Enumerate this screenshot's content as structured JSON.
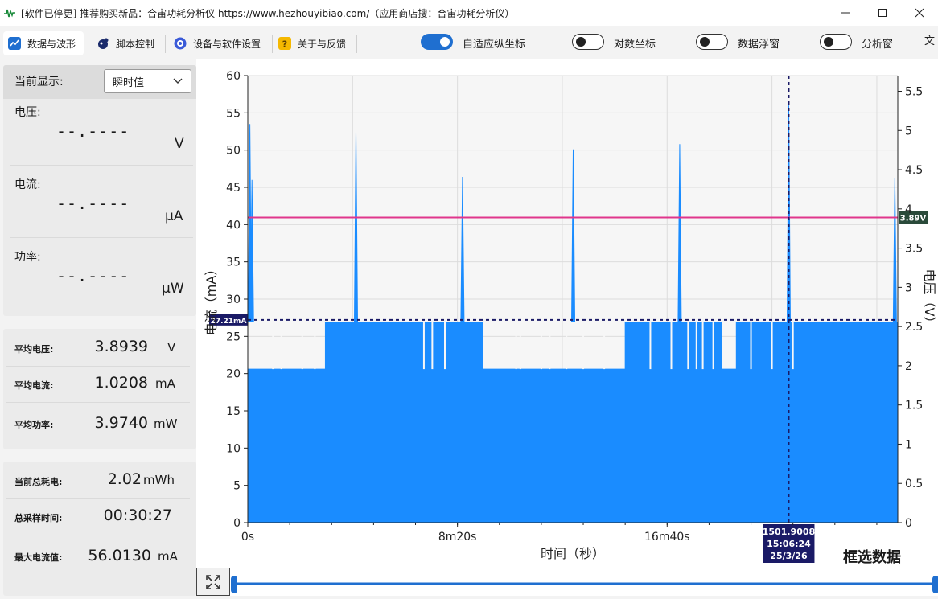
{
  "window": {
    "title": "[软件已停更] 推荐购买新品：合宙功耗分析仪 https://www.hezhouyibiao.com/（应用商店搜：合宙功耗分析仪）"
  },
  "toolbar": {
    "tabs": [
      {
        "label": "数据与波形",
        "icon": "chart-line-icon"
      },
      {
        "label": "脚本控制",
        "icon": "script-icon"
      },
      {
        "label": "设备与软件设置",
        "icon": "gear-icon"
      },
      {
        "label": "关于与反馈",
        "icon": "question-icon"
      }
    ],
    "toggles": [
      {
        "label": "自适应纵坐标",
        "on": true
      },
      {
        "label": "对数坐标",
        "on": false
      },
      {
        "label": "数据浮窗",
        "on": false
      },
      {
        "label": "分析窗",
        "on": false
      }
    ],
    "lang_icon": "translate-icon"
  },
  "left": {
    "current_label": "当前显示:",
    "current_value": "瞬时值",
    "meters": [
      {
        "label": "电压:",
        "value": "--.----",
        "unit": "V"
      },
      {
        "label": "电流:",
        "value": "--.----",
        "unit": "μA"
      },
      {
        "label": "功率:",
        "value": "--.----",
        "unit": "μW"
      }
    ],
    "averages": [
      {
        "label": "平均电压:",
        "value": "3.8939",
        "unit": "V"
      },
      {
        "label": "平均电流:",
        "value": "1.0208",
        "unit": "mA"
      },
      {
        "label": "平均功率:",
        "value": "3.9740",
        "unit": "mW"
      }
    ],
    "totals": [
      {
        "label": "当前总耗电:",
        "value": "2.02",
        "unit": "mWh"
      },
      {
        "label": "总采样时间:",
        "value": "00:30:27",
        "unit": ""
      },
      {
        "label": "最大电流值:",
        "value": "56.0130",
        "unit": "mA"
      }
    ]
  },
  "colors": {
    "accent": "#1f6fd0",
    "current": "#1a8cff",
    "voltage": "#e0368c",
    "marker": "#1a1a66"
  },
  "chart_data": {
    "type": "area",
    "xlabel": "时间（秒）",
    "ylabel": "电流（mA）",
    "ylabel_right": "电压（V）",
    "xlim": [
      0,
      1550
    ],
    "ylim": [
      0,
      60
    ],
    "ylim_right": [
      0,
      5.7
    ],
    "x_ticks": [
      {
        "value": 0,
        "label": "0s"
      },
      {
        "value": 500,
        "label": "8m20s"
      },
      {
        "value": 1000,
        "label": "16m40s"
      }
    ],
    "y_ticks": [
      0,
      5,
      10,
      15,
      20,
      25,
      30,
      35,
      40,
      45,
      50,
      55,
      60
    ],
    "y_ticks_right": [
      0,
      0.5,
      1,
      1.5,
      2,
      2.5,
      3,
      3.5,
      4,
      4.5,
      5,
      5.5
    ],
    "series": [
      {
        "name": "电流",
        "segments": [
          [
            0,
            20.6
          ],
          [
            185,
            26.9
          ],
          [
            560,
            20.6
          ],
          [
            900,
            26.9
          ],
          [
            1130,
            20.6
          ],
          [
            1165,
            26.9
          ],
          [
            1550,
            20.6
          ]
        ],
        "dips": [
          60,
          80,
          130,
          160,
          420,
          440,
          470,
          640,
          650,
          700,
          720,
          760,
          800,
          850,
          960,
          1010,
          1050,
          1070,
          1085,
          1110,
          1200,
          1250,
          1300
        ],
        "spikes": [
          [
            5,
            53.5
          ],
          [
            10,
            46
          ],
          [
            258,
            52.4
          ],
          [
            512,
            46.4
          ],
          [
            776,
            50.1
          ],
          [
            1030,
            50.8
          ],
          [
            1290,
            56.0
          ],
          [
            1543,
            46.2
          ]
        ]
      },
      {
        "name": "电压",
        "constant": 3.89
      }
    ],
    "marker_current": {
      "value": 27.21,
      "label": "27.21mA"
    },
    "marker_voltage": {
      "value": 3.89,
      "label": "3.89V"
    },
    "cursor": {
      "x": 1290,
      "label_lines": [
        "1501.9008",
        "15:06:24",
        "25/3/26"
      ]
    }
  },
  "range_select_label": "框选数据"
}
